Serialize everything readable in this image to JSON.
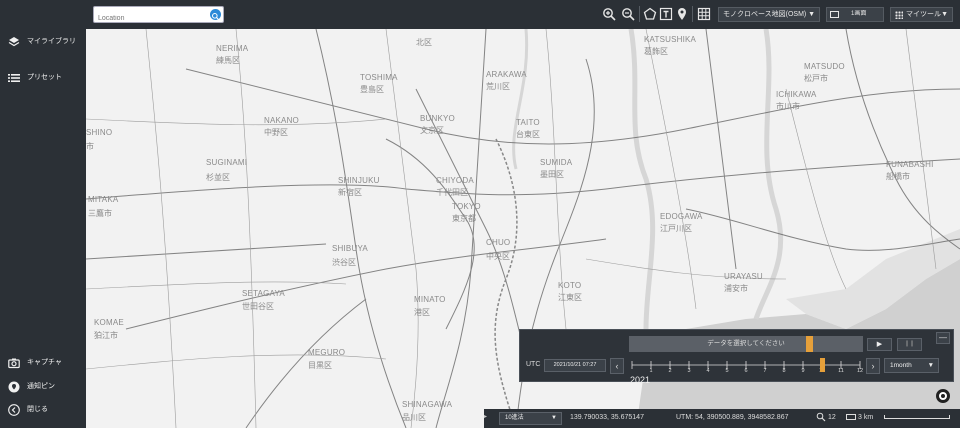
{
  "search": {
    "placeholder": "Location",
    "value": ""
  },
  "sidebar": {
    "items": [
      {
        "label": "マイライブラリ",
        "icon": "layers-icon"
      },
      {
        "label": "プリセット",
        "icon": "list-icon"
      }
    ],
    "bottom_items": [
      {
        "label": "キャプチャ",
        "icon": "camera-icon"
      },
      {
        "label": "通知ピン",
        "icon": "pin-icon"
      },
      {
        "label": "閉じる",
        "icon": "chevron-left-circle-icon"
      }
    ]
  },
  "toolbar": {
    "basemap_label": "モノクロベース地図(OSM)",
    "screen_label": "1画面",
    "mytools_label": "マイツール"
  },
  "map": {
    "areas": [
      {
        "en": "NERIMA",
        "ja": "練馬区"
      },
      {
        "en": "TOSHIMA",
        "ja": "豊島区"
      },
      {
        "en": "ARAKAWA",
        "ja": "荒川区"
      },
      {
        "en": "KATSUSHIKA",
        "ja": "葛飾区"
      },
      {
        "en": "MATSUDO",
        "ja": "松戸市"
      },
      {
        "en": "ICHIKAWA",
        "ja": "市川市"
      },
      {
        "en": "NAKANO",
        "ja": "中野区"
      },
      {
        "en": "BUNKYO",
        "ja": "文京区"
      },
      {
        "en": "TAITO",
        "ja": "台東区"
      },
      {
        "en": "SUMIDA",
        "ja": "墨田区"
      },
      {
        "en": "FUNABASHI",
        "ja": "船橋市"
      },
      {
        "en": "SHINO",
        "ja": "市"
      },
      {
        "en": "SUGINAMI",
        "ja": "杉並区"
      },
      {
        "en": "SHINJUKU",
        "ja": "新宿区"
      },
      {
        "en": "CHIYODA",
        "ja": "千代田区"
      },
      {
        "en": "TOKYO",
        "ja": "東京都"
      },
      {
        "en": "EDOGAWA",
        "ja": "江戸川区"
      },
      {
        "en": "MITAKA",
        "ja": "三鷹市"
      },
      {
        "en": "SHIBUYA",
        "ja": "渋谷区"
      },
      {
        "en": "CHUO",
        "ja": "中央区"
      },
      {
        "en": "URAYASU",
        "ja": "浦安市"
      },
      {
        "en": "SETAGAYA",
        "ja": "世田谷区"
      },
      {
        "en": "KOTO",
        "ja": "江東区"
      },
      {
        "en": "MINATO",
        "ja": "港区"
      },
      {
        "en": "KOMAE",
        "ja": "狛江市"
      },
      {
        "en": "MEGURO",
        "ja": "目黒区"
      },
      {
        "en": "SHINAGAWA",
        "ja": "品川区"
      },
      {
        "en": "",
        "ja": "北区"
      }
    ]
  },
  "time": {
    "close_label": "—",
    "data_select_label": "データを選択してください",
    "play_label": "▶",
    "pause_label": "❙❙",
    "utc_label": "UTC",
    "date_value": "2021/10/21 07:27",
    "prev_label": "‹",
    "next_label": "›",
    "month_ticks": [
      "1",
      "2",
      "3",
      "4",
      "5",
      "6",
      "7",
      "8",
      "9",
      "10",
      "11",
      "12"
    ],
    "year_label": "2021",
    "step_label": "1month",
    "marker_month": 10,
    "accent": "#e6a03a"
  },
  "status": {
    "coord_type": "10進法",
    "lonlat": "139.790033, 35.675147",
    "utm": "UTM: 54, 390500.889, 3948582.867",
    "zoom": "12",
    "scale": "3 km"
  }
}
